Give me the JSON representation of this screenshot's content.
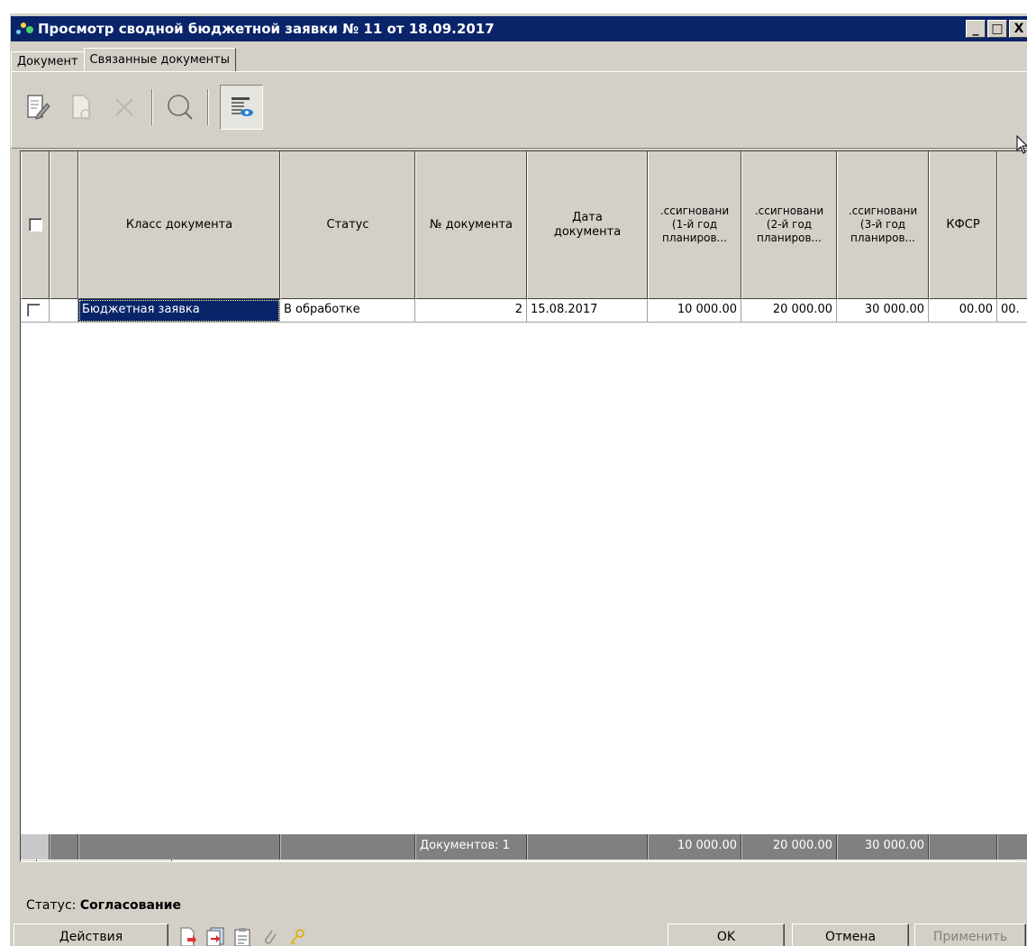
{
  "window": {
    "title": "Просмотр сводной бюджетной заявки № 11 от 18.09.2017",
    "min_glyph": "_",
    "max_glyph": "□",
    "close_glyph": "X"
  },
  "tabs": [
    {
      "label": "Документ",
      "active": false
    },
    {
      "label": "Связанные документы",
      "active": true
    }
  ],
  "toolbar": {
    "icons": [
      "edit-document-icon",
      "new-document-icon",
      "delete-icon",
      "search-icon",
      "view-list-icon"
    ]
  },
  "grid": {
    "headers": {
      "doc_class": "Класс документа",
      "status": "Статус",
      "doc_num": "№ документа",
      "doc_date": "Дата\nдокумента",
      "alloc1": ".ссигновани\n(1-й год\nпланиров...",
      "alloc2": ".ссигновани\n(2-й год\nпланиров...",
      "alloc3": ".ссигновани\n(3-й год\nпланиров...",
      "kfsr": "КФСР"
    },
    "rows": [
      {
        "doc_class": "Бюджетная заявка",
        "status": "В обработке",
        "doc_num": "2",
        "doc_date": "15.08.2017",
        "alloc1": "10 000.00",
        "alloc2": "20 000.00",
        "alloc3": "30 000.00",
        "kfsr": "00.00",
        "extra": "00."
      }
    ],
    "footer": {
      "count": "Документов: 1",
      "alloc1": "10 000.00",
      "alloc2": "20 000.00",
      "alloc3": "30 000.00"
    }
  },
  "status": {
    "label": "Статус:",
    "value": "Согласование"
  },
  "bottom": {
    "actions_label": "Действия",
    "ok_label": "OK",
    "cancel_label": "Отмена",
    "apply_label": "Применить"
  }
}
